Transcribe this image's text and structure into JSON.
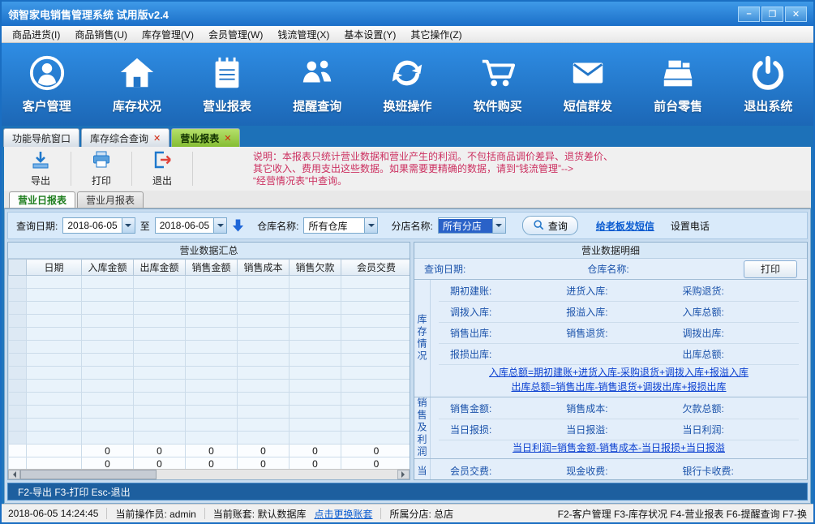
{
  "window": {
    "title": "领智家电销售管理系统 试用版v2.4",
    "minimize": "–",
    "maximize": "❐",
    "close": "✕"
  },
  "menubar": {
    "items": [
      "商品进货(I)",
      "商品销售(U)",
      "库存管理(V)",
      "会员管理(W)",
      "钱流管理(X)",
      "基本设置(Y)",
      "其它操作(Z)"
    ]
  },
  "toolbar": {
    "items": [
      {
        "label": "客户管理"
      },
      {
        "label": "库存状况"
      },
      {
        "label": "营业报表"
      },
      {
        "label": "提醒查询"
      },
      {
        "label": "换班操作"
      },
      {
        "label": "软件购买"
      },
      {
        "label": "短信群发"
      },
      {
        "label": "前台零售"
      },
      {
        "label": "退出系统"
      }
    ]
  },
  "tabs": [
    {
      "label": "功能导航窗口",
      "close": ""
    },
    {
      "label": "库存综合查询",
      "close": "✕"
    },
    {
      "label": "营业报表",
      "close": "✕"
    }
  ],
  "actionbar": {
    "export": "导出",
    "print": "打印",
    "exit": "退出",
    "notice_line1": "说明：本报表只统计营业数据和营业产生的利润。不包括商品调价差异、退货差价、",
    "notice_line2": "其它收入、费用支出这些数据。如果需要更精确的数据，请到“钱流管理”-->",
    "notice_line3": "“经营情况表”中查询。"
  },
  "report_tabs": {
    "daily": "营业日报表",
    "monthly": "营业月报表"
  },
  "query": {
    "date_label": "查询日期:",
    "date_from": "2018-06-05",
    "to_label": "至",
    "date_to": "2018-06-05",
    "warehouse_label": "仓库名称:",
    "warehouse_value": "所有仓库",
    "branch_label": "分店名称:",
    "branch_value": "所有分店",
    "search_button": "查询",
    "sms_link": "给老板发短信",
    "phone_setting": "设置电话"
  },
  "summary": {
    "title": "营业数据汇总",
    "columns": [
      "日期",
      "入库金额",
      "出库金额",
      "销售金额",
      "销售成本",
      "销售欠款",
      "会员交费"
    ],
    "empty_row_count": 13,
    "total_rows": [
      [
        "0",
        "0",
        "0",
        "0",
        "0",
        "0"
      ],
      [
        "0",
        "0",
        "0",
        "0",
        "0",
        "0"
      ]
    ]
  },
  "detail": {
    "title": "营业数据明细",
    "query_date_label": "查询日期:",
    "warehouse_label": "仓库名称:",
    "print_button": "打印",
    "inventory": {
      "side_label": "库存情况",
      "rows": [
        [
          "期初建账:",
          "进货入库:",
          "采购退货:"
        ],
        [
          "调拨入库:",
          "报溢入库:",
          "入库总额:"
        ],
        [
          "销售出库:",
          "销售退货:",
          "调拨出库:"
        ],
        [
          "报损出库:",
          "",
          "出库总额:"
        ]
      ],
      "formulas": [
        "入库总额=期初建账+进货入库-采购退货+调拨入库+报溢入库",
        "出库总额=销售出库-销售退货+调拨出库+报损出库"
      ]
    },
    "sales": {
      "side_label": "销售及利润",
      "rows": [
        [
          "销售金额:",
          "销售成本:",
          "欠款总额:"
        ],
        [
          "当日报损:",
          "当日报溢:",
          "当日利润:"
        ]
      ],
      "formulas": [
        "当日利润=销售金额-销售成本-当日报损+当日报溢"
      ]
    },
    "fees": {
      "side_label": "当",
      "rows": [
        [
          "会员交费:",
          "现金收费:",
          "银行卡收费:"
        ]
      ]
    }
  },
  "hintbar": {
    "text": "F2-导出 F3-打印 Esc-退出"
  },
  "statusbar": {
    "datetime": "2018-06-05 14:24:45",
    "operator": "当前操作员: admin",
    "account": "当前账套: 默认数据库",
    "switch_link": "点击更换账套",
    "branch": "所属分店: 总店",
    "hotkeys": "F2-客户管理 F3-库存状况 F4-营业报表 F6-提醒查询 F7-换"
  }
}
